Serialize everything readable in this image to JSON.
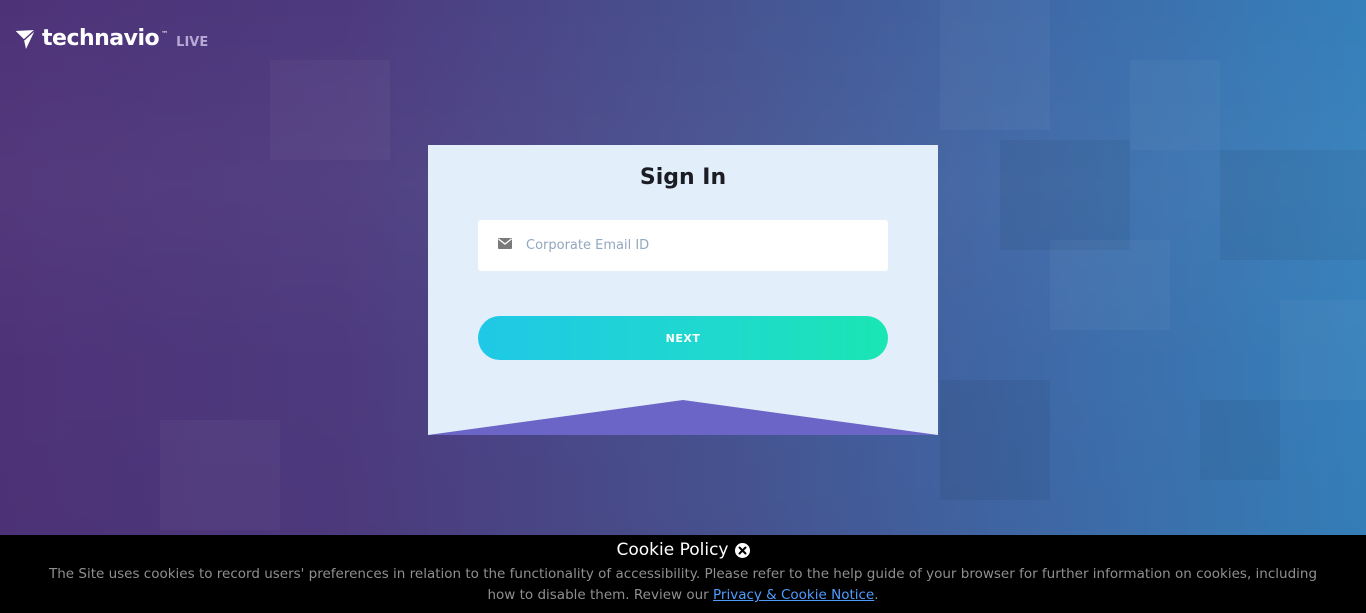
{
  "brand": {
    "name": "technavio",
    "trademark": "™",
    "suffix": "LIVE"
  },
  "signin": {
    "title": "Sign In",
    "email": {
      "placeholder": "Corporate Email ID",
      "value": "",
      "icon": "envelope-icon"
    },
    "next_label": "NEXT"
  },
  "cookie": {
    "title": "Cookie Policy",
    "close_icon": "close-circle-icon",
    "text": "The Site uses cookies to record users' preferences in relation to the functionality of accessibility. Please refer to the help guide of your browser for further information on cookies, including how to disable them. Review our ",
    "link_label": "Privacy & Cookie Notice",
    "text_end": "."
  },
  "colors": {
    "background_start": "#4e3278",
    "background_end": "#3580bb",
    "card": "#e2eef9",
    "button_start": "#1fc8e6",
    "button_end": "#1ae6b3",
    "ribbon": "#6b65c8",
    "link": "#4f9cff"
  }
}
